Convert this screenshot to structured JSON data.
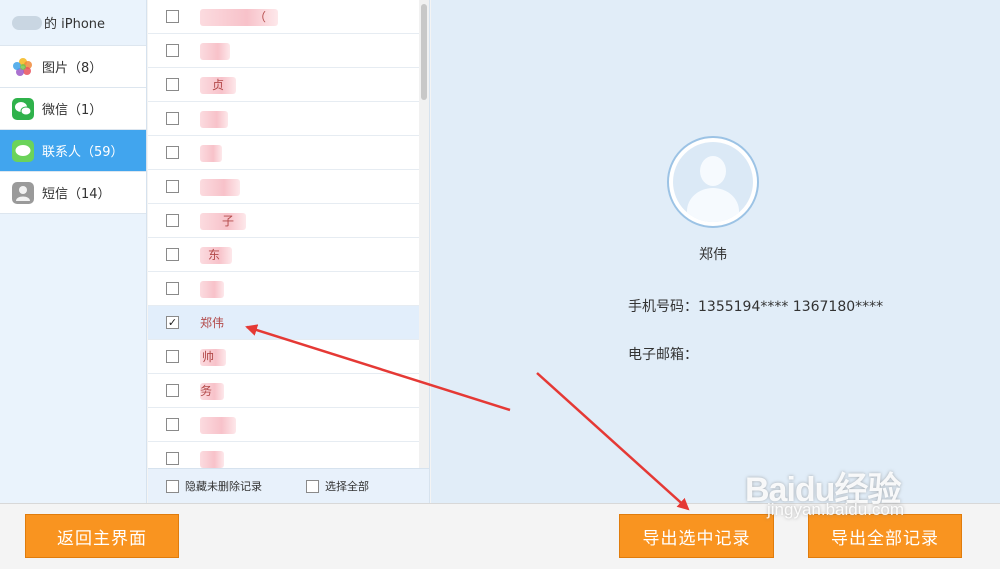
{
  "sidebar": {
    "device_label": "的 iPhone",
    "items": [
      {
        "label": "图片（8）",
        "icon": "photos-icon"
      },
      {
        "label": "微信（1）",
        "icon": "wechat-icon"
      },
      {
        "label": "联系人（59）",
        "icon": "contacts-message-icon",
        "active": true
      },
      {
        "label": "短信（14）",
        "icon": "sms-contact-icon"
      }
    ]
  },
  "contacts": {
    "rows": [
      {
        "text": "（",
        "checked": false
      },
      {
        "text": "",
        "checked": false
      },
      {
        "text": "贞",
        "checked": false
      },
      {
        "text": "",
        "checked": false
      },
      {
        "text": "",
        "checked": false
      },
      {
        "text": "",
        "checked": false
      },
      {
        "text": "子",
        "checked": false
      },
      {
        "text": "东",
        "checked": false
      },
      {
        "text": "",
        "checked": false
      },
      {
        "text": "郑伟",
        "checked": true
      },
      {
        "text": "帅",
        "checked": false
      },
      {
        "text": "务",
        "checked": false
      },
      {
        "text": "",
        "checked": false
      },
      {
        "text": "",
        "checked": false
      }
    ],
    "footer": {
      "hide_deleted": "隐藏未删除记录",
      "select_all": "选择全部"
    }
  },
  "detail": {
    "name": "郑伟",
    "phone_label": "手机号码：",
    "phone_value": "1355194**** 1367180****",
    "email_label": "电子邮箱：",
    "email_value": ""
  },
  "buttons": {
    "back": "返回主界面",
    "export_selected": "导出选中记录",
    "export_all": "导出全部记录"
  },
  "watermark": {
    "brand": "Baidu经验",
    "site": "jingyan.baidu.com"
  },
  "colors": {
    "accent_blue": "#41a5ee",
    "button_orange": "#f99420",
    "annotation_red": "#e53935"
  }
}
